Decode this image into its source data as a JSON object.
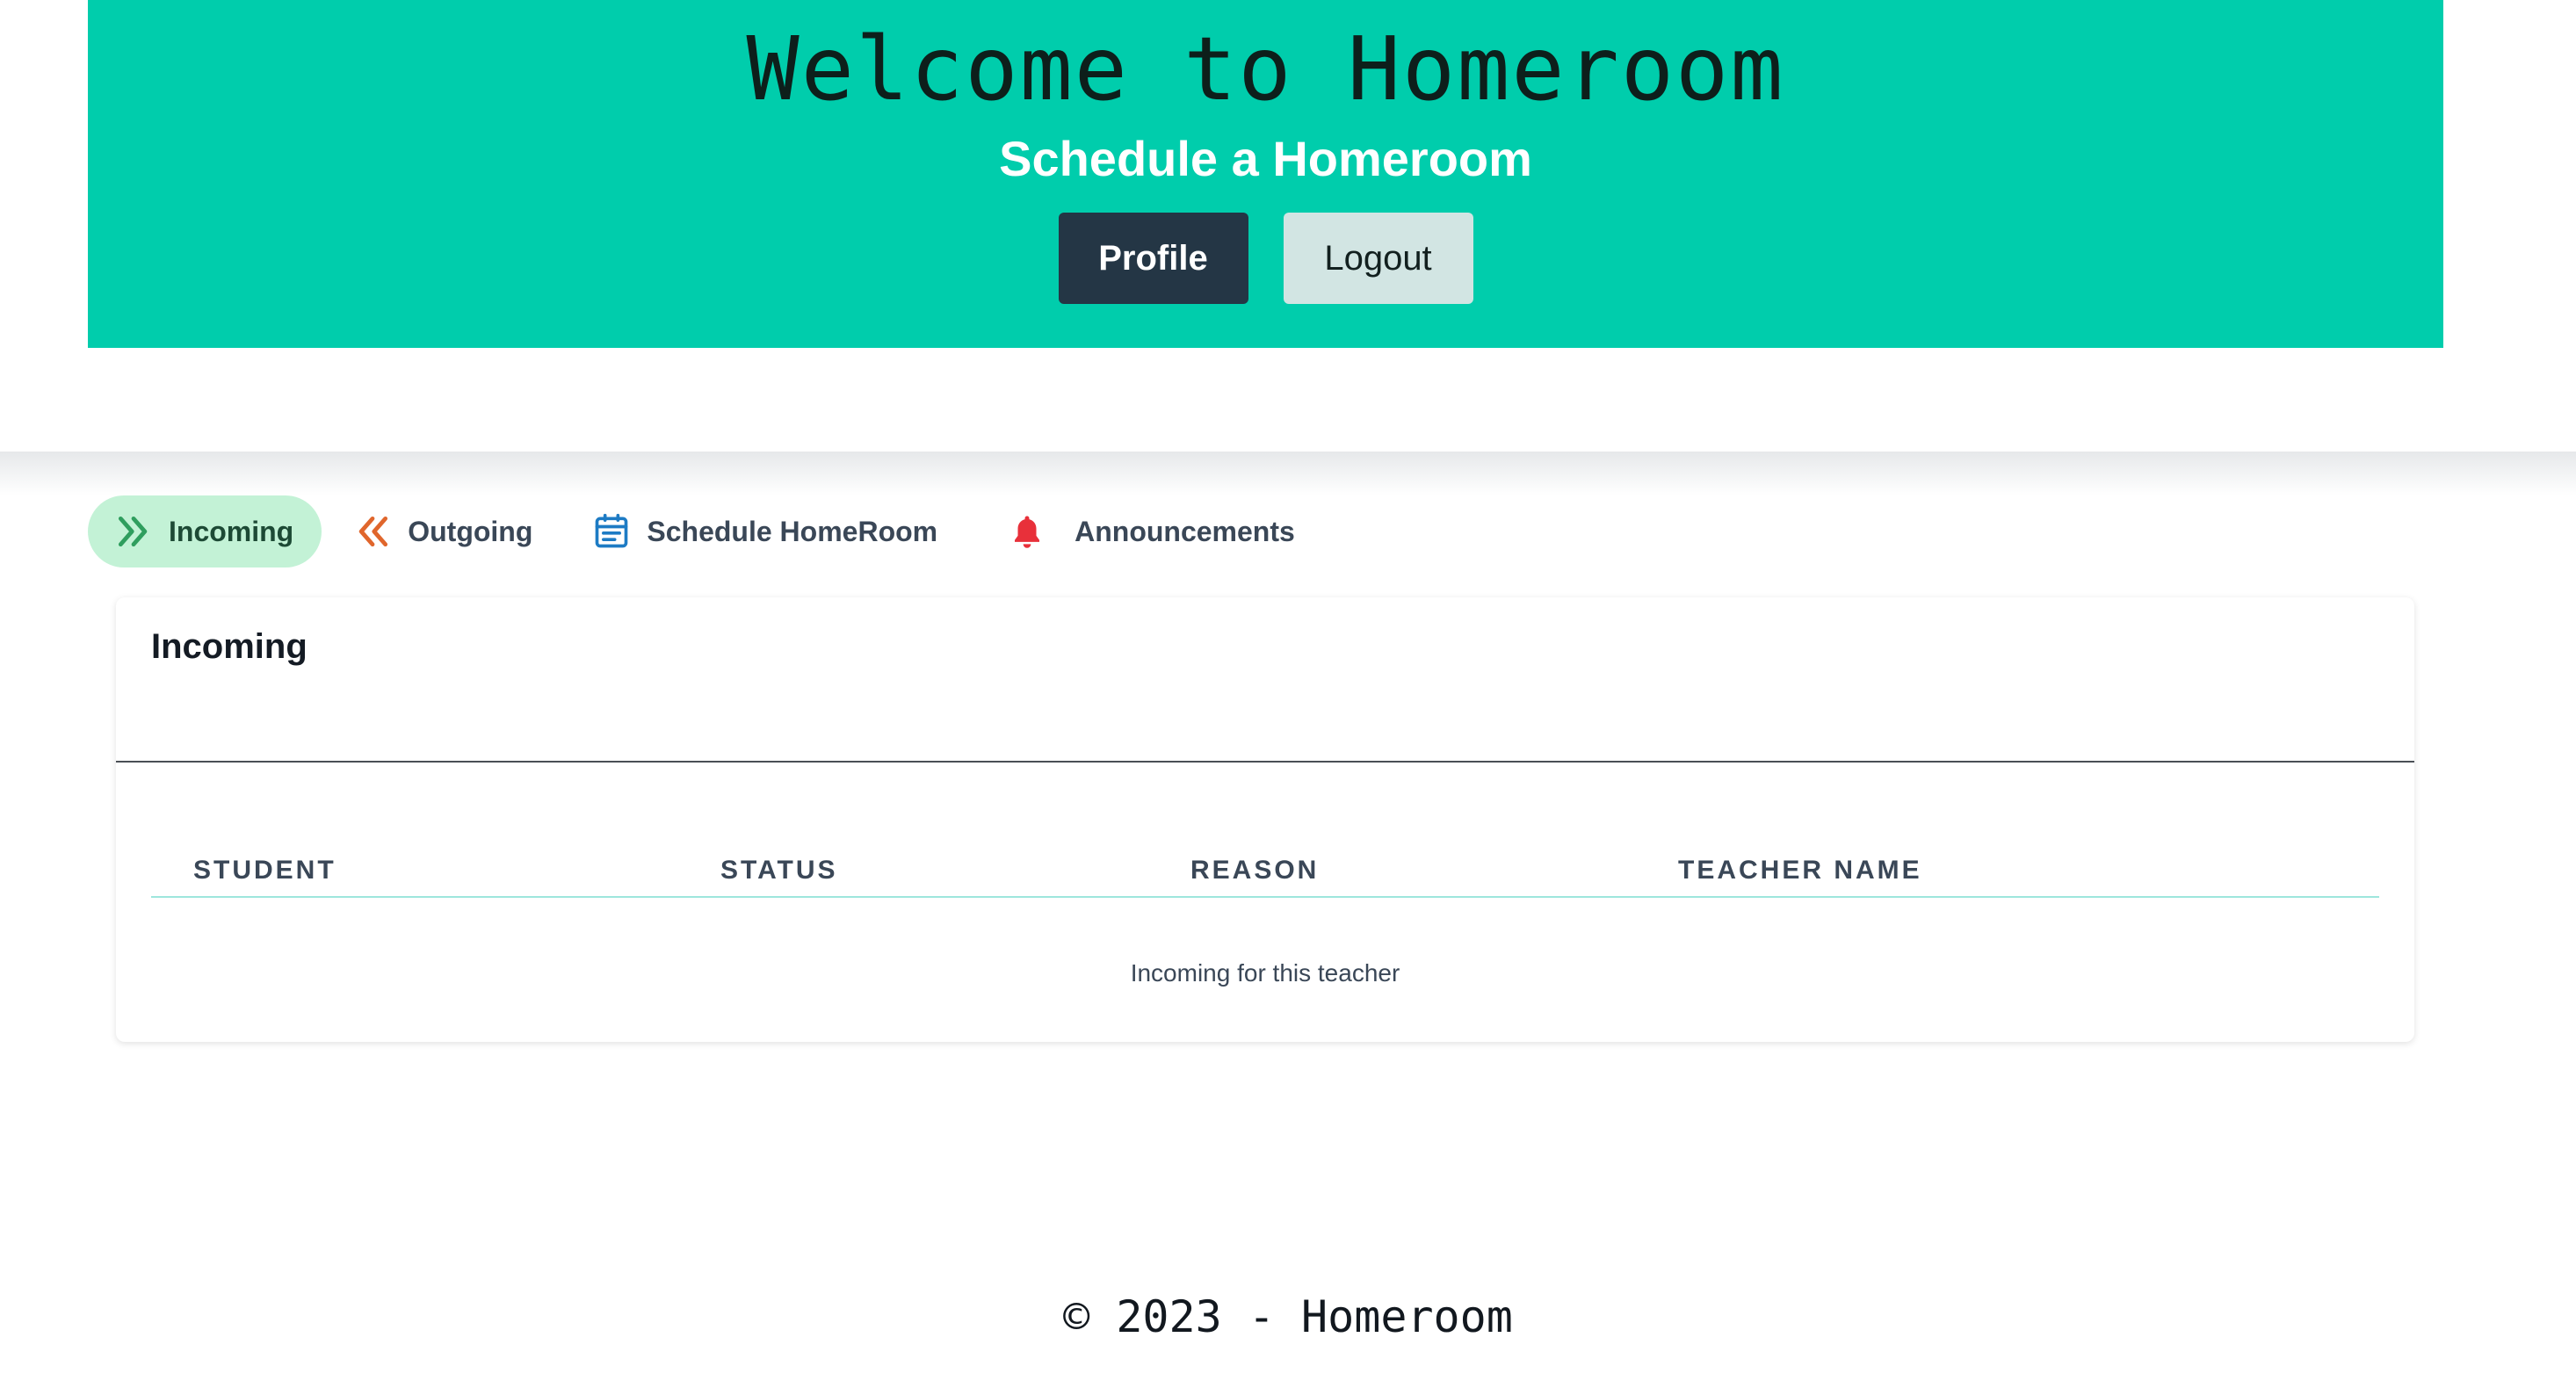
{
  "header": {
    "title": "Welcome to Homeroom",
    "subtitle": "Schedule a Homeroom",
    "profile_label": "Profile",
    "logout_label": "Logout"
  },
  "tabs": [
    {
      "label": "Incoming",
      "icon": "chevrons-right-icon",
      "active": true,
      "color": "#2f9e5e"
    },
    {
      "label": "Outgoing",
      "icon": "chevrons-left-icon",
      "active": false,
      "color": "#e0662c"
    },
    {
      "label": "Schedule HomeRoom",
      "icon": "calendar-icon",
      "active": false,
      "color": "#1d7bc4"
    },
    {
      "label": "Announcements",
      "icon": "bell-icon",
      "active": false,
      "color": "#e8303a"
    }
  ],
  "card": {
    "title": "Incoming",
    "columns": [
      "STUDENT",
      "STATUS",
      "REASON",
      "TEACHER NAME"
    ],
    "empty_message": "Incoming for this teacher"
  },
  "footer": {
    "text": "© 2023 - Homeroom"
  },
  "colors": {
    "hero_bg": "#00cdac",
    "profile_bg": "#243645",
    "logout_bg": "#d2e5e3",
    "active_tab_bg": "#c3f2d6"
  }
}
